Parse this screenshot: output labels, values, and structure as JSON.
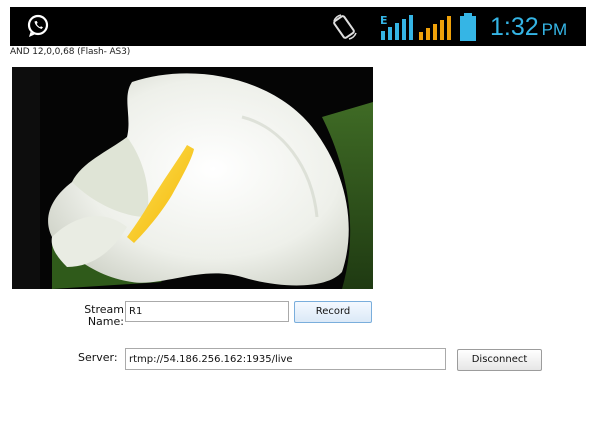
{
  "status_bar": {
    "notification_icon": "whatsapp-icon",
    "rotation_icon": "screen-rotation-icon",
    "signal_icons": [
      "mobile-data-signal-icon",
      "cellular-signal-icon"
    ],
    "data_type": "E",
    "battery_icon": "battery-icon",
    "time": "1:32",
    "ampm": "PM",
    "accent_color": "#35b5e5",
    "signal_color": "#f0a20a"
  },
  "app": {
    "version_text": "AND 12,0,0,68 (Flash- AS3)",
    "video_content": "calla-lily-image",
    "stream_name_label": "Stream\nName:",
    "stream_name_value": "R1",
    "record_label": "Record",
    "server_label": "Server:",
    "server_value": "rtmp://54.186.256.162:1935/live",
    "disconnect_label": "Disconnect"
  }
}
